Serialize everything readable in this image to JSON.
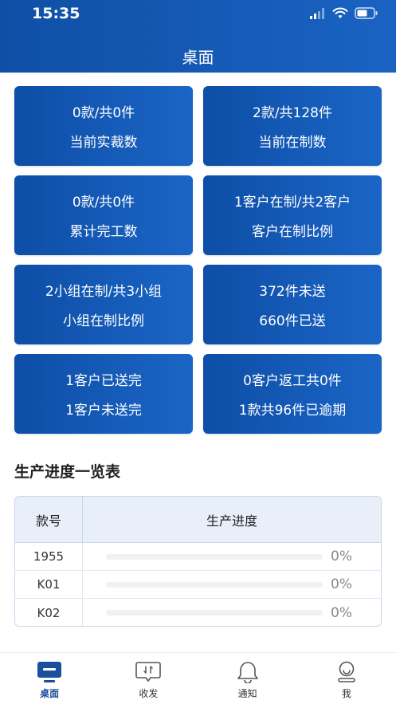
{
  "status_bar": {
    "time": "15:35"
  },
  "header": {
    "title": "桌面"
  },
  "cards": [
    {
      "line1": "0款/共0件",
      "line2": "当前实裁数"
    },
    {
      "line1": "2款/共128件",
      "line2": "当前在制数"
    },
    {
      "line1": "0款/共0件",
      "line2": "累计完工数"
    },
    {
      "line1": "1客户在制/共2客户",
      "line2": "客户在制比例"
    },
    {
      "line1": "2小组在制/共3小组",
      "line2": "小组在制比例"
    },
    {
      "line1": "372件未送",
      "line2": "660件已送"
    },
    {
      "line1": "1客户已送完",
      "line2": "1客户未送完"
    },
    {
      "line1": "0客户返工共0件",
      "line2": "1款共96件已逾期"
    }
  ],
  "progress_section": {
    "title": "生产进度一览表",
    "headers": {
      "style_no": "款号",
      "progress": "生产进度"
    },
    "rows": [
      {
        "style_no": "1955",
        "progress_text": "0%",
        "progress_value": 0
      },
      {
        "style_no": "K01",
        "progress_text": "0%",
        "progress_value": 0
      },
      {
        "style_no": "K02",
        "progress_text": "0%",
        "progress_value": 0
      }
    ]
  },
  "tabbar": {
    "items": [
      {
        "label": "桌面",
        "icon": "desktop-icon",
        "active": true
      },
      {
        "label": "收发",
        "icon": "transfer-icon",
        "active": false
      },
      {
        "label": "通知",
        "icon": "bell-icon",
        "active": false
      },
      {
        "label": "我",
        "icon": "user-icon",
        "active": false
      }
    ]
  },
  "colors": {
    "primary": "#1a63c2",
    "primary_dark": "#0d4ea6",
    "tab_active": "#1a4f9e",
    "table_header_bg": "#e8eff9"
  }
}
